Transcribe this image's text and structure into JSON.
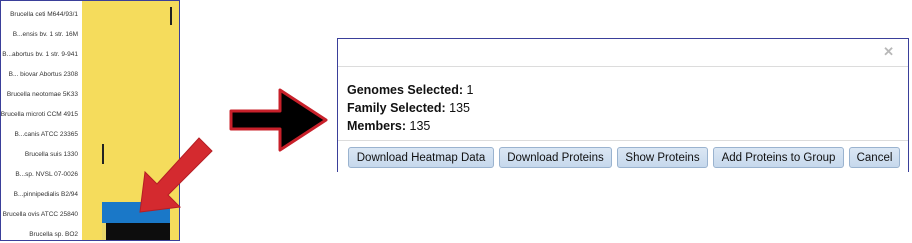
{
  "heatmap": {
    "genomes": [
      "Brucella ceti M644/93/1",
      "B...ensis bv. 1 str. 16M",
      "B...abortus bv. 1 str. 9-941",
      "B... biovar Abortus 2308",
      "Brucella neotomae 5K33",
      "Brucella microti CCM 4915",
      "B...canis ATCC 23365",
      "Brucella suis 1330",
      "B...sp. NVSL 07-0026",
      "B...pinnipedialis B2/94",
      "Brucella ovis ATCC 25840",
      "Brucella sp. BO2"
    ],
    "colors": {
      "cell": "#f5dc5c",
      "selected": "#1a78c8",
      "highlight": "#0d0d0d"
    }
  },
  "dialog": {
    "close_icon": "close-icon",
    "genomes_key": "Genomes Selected:",
    "genomes_value": "1",
    "family_key": "Family Selected:",
    "family_value": "135",
    "members_key": "Members:",
    "members_value": "135",
    "buttons": {
      "download_heatmap": "Download Heatmap Data",
      "download_proteins": "Download Proteins",
      "show_proteins": "Show Proteins",
      "add_to_group": "Add Proteins to Group",
      "cancel": "Cancel"
    }
  },
  "annotations": {
    "arrow_color": "#c8202a",
    "arrow_fill": "#000000"
  }
}
